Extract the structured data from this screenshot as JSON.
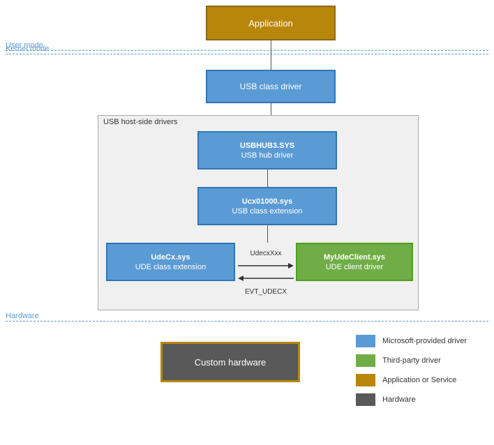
{
  "boxes": {
    "application": {
      "label": "Application"
    },
    "usbClassDriver": {
      "label": "USB class driver"
    },
    "usbHostSide": {
      "label": "USB host-side drivers"
    },
    "usbhub": {
      "line1": "USBHUB3.SYS",
      "line2": "USB hub driver"
    },
    "ucx": {
      "line1": "Ucx01000.sys",
      "line2": "USB class extension"
    },
    "udecx": {
      "line1": "UdeCx.sys",
      "line2": "UDE class extension"
    },
    "myude": {
      "line1": "MyUdeClient.sys",
      "line2": "UDE client driver"
    },
    "customHw": {
      "label": "Custom hardware"
    }
  },
  "arrows": {
    "labelTop": "UdecxXxx",
    "labelBottom": "EVT_UDECX"
  },
  "modes": {
    "userMode": "User mode",
    "kernelMode": "Kernel mode",
    "hardware": "Hardware"
  },
  "legend": [
    {
      "color": "#5b9bd5",
      "text": "Microsoft-provided driver"
    },
    {
      "color": "#70ad47",
      "text": "Third-party driver"
    },
    {
      "color": "#b8860b",
      "text": "Application or Service"
    },
    {
      "color": "#595959",
      "text": "Hardware"
    }
  ]
}
